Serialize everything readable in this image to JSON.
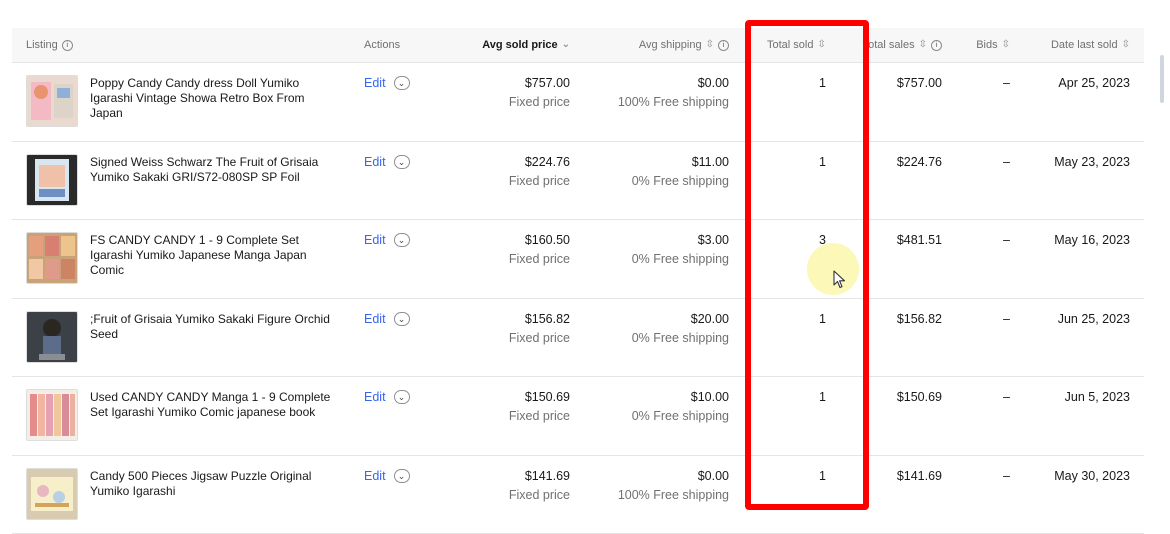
{
  "header": {
    "listing": "Listing",
    "actions": "Actions",
    "avg_sold_price": "Avg sold price",
    "avg_shipping": "Avg shipping",
    "total_sold": "Total sold",
    "total_sales": "Total sales",
    "bids": "Bids",
    "date_last_sold": "Date last sold"
  },
  "edit_label": "Edit",
  "rows": [
    {
      "title": "Poppy Candy Candy dress Doll Yumiko Igarashi Vintage Showa Retro Box From Japan",
      "price": "$757.00",
      "price_type": "Fixed price",
      "shipping": "$0.00",
      "shipping_note": "100% Free shipping",
      "total_sold": "1",
      "total_sales": "$757.00",
      "bids": "–",
      "date": "Apr 25, 2023"
    },
    {
      "title": "Signed Weiss Schwarz The Fruit of Grisaia Yumiko Sakaki GRI/S72-080SP SP Foil",
      "price": "$224.76",
      "price_type": "Fixed price",
      "shipping": "$11.00",
      "shipping_note": "0% Free shipping",
      "total_sold": "1",
      "total_sales": "$224.76",
      "bids": "–",
      "date": "May 23, 2023"
    },
    {
      "title": "FS CANDY CANDY 1 - 9 Complete Set Igarashi Yumiko Japanese Manga Japan Comic",
      "price": "$160.50",
      "price_type": "Fixed price",
      "shipping": "$3.00",
      "shipping_note": "0% Free shipping",
      "total_sold": "3",
      "total_sales": "$481.51",
      "bids": "–",
      "date": "May 16, 2023"
    },
    {
      "title": ";Fruit of Grisaia Yumiko Sakaki Figure Orchid Seed",
      "price": "$156.82",
      "price_type": "Fixed price",
      "shipping": "$20.00",
      "shipping_note": "0% Free shipping",
      "total_sold": "1",
      "total_sales": "$156.82",
      "bids": "–",
      "date": "Jun 25, 2023"
    },
    {
      "title": "Used CANDY CANDY Manga 1 - 9 Complete Set Igarashi Yumiko Comic japanese book",
      "price": "$150.69",
      "price_type": "Fixed price",
      "shipping": "$10.00",
      "shipping_note": "0% Free shipping",
      "total_sold": "1",
      "total_sales": "$150.69",
      "bids": "–",
      "date": "Jun 5, 2023"
    },
    {
      "title": "Candy 500 Pieces Jigsaw Puzzle Original Yumiko Igarashi",
      "price": "$141.69",
      "price_type": "Fixed price",
      "shipping": "$0.00",
      "shipping_note": "100% Free shipping",
      "total_sold": "1",
      "total_sales": "$141.69",
      "bids": "–",
      "date": "May 30, 2023"
    }
  ],
  "colors": {
    "link": "#3665f3",
    "highlight": "#ff0000",
    "header_bg": "#f7f7f7"
  }
}
